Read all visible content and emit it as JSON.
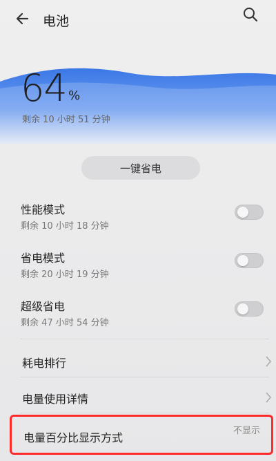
{
  "header": {
    "title": "电池"
  },
  "battery": {
    "percent": "64",
    "percent_sign": "%",
    "remaining": "剩余 10 小时 51 分钟",
    "level_fraction": 0.64,
    "wave_color": "#3f7fe8"
  },
  "one_click": {
    "label": "一键省电"
  },
  "modes": [
    {
      "label": "性能模式",
      "sub": "剩余 10 小时 18 分钟",
      "enabled": false
    },
    {
      "label": "省电模式",
      "sub": "剩余 20 小时 19 分钟",
      "enabled": false
    },
    {
      "label": "超级省电",
      "sub": "剩余 47 小时 54 分钟",
      "enabled": false
    }
  ],
  "nav_items": [
    {
      "label": "耗电排行"
    },
    {
      "label": "电量使用详情"
    }
  ],
  "percent_display": {
    "label": "电量百分比显示方式",
    "value": "不显示"
  },
  "colors": {
    "highlight": "#ff2a2a",
    "accent": "#3f7fe8"
  }
}
